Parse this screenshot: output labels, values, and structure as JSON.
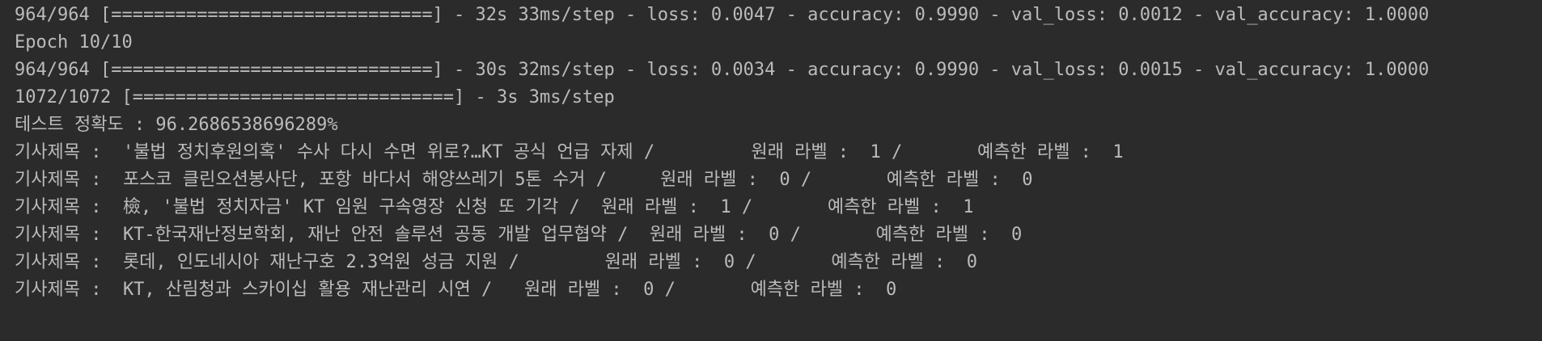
{
  "console": {
    "lines": [
      "964/964 [==============================] - 32s 33ms/step - loss: 0.0047 - accuracy: 0.9990 - val_loss: 0.0012 - val_accuracy: 1.0000",
      "Epoch 10/10",
      "964/964 [==============================] - 30s 32ms/step - loss: 0.0034 - accuracy: 0.9990 - val_loss: 0.0015 - val_accuracy: 1.0000",
      "1072/1072 [==============================] - 3s 3ms/step",
      "테스트 정확도 : 96.2686538696289%",
      "기사제목 :  '불법 정치후원의혹' 수사 다시 수면 위로?…KT 공식 언급 자제 /         원래 라벨 :  1 /       예측한 라벨 :  1",
      "기사제목 :  포스코 클린오션봉사단, 포항 바다서 해양쓰레기 5톤 수거 /     원래 라벨 :  0 /       예측한 라벨 :  0",
      "기사제목 :  檢, '불법 정치자금' KT 임원 구속영장 신청 또 기각 /  원래 라벨 :  1 /       예측한 라벨 :  1",
      "기사제목 :  KT-한국재난정보학회, 재난 안전 솔루션 공동 개발 업무협약 /  원래 라벨 :  0 /       예측한 라벨 :  0",
      "기사제목 :  롯데, 인도네시아 재난구호 2.3억원 성금 지원 /        원래 라벨 :  0 /       예측한 라벨 :  0",
      "기사제목 :  KT, 산림청과 스카이십 활용 재난관리 시연 /   원래 라벨 :  0 /       예측한 라벨 :  0"
    ]
  }
}
